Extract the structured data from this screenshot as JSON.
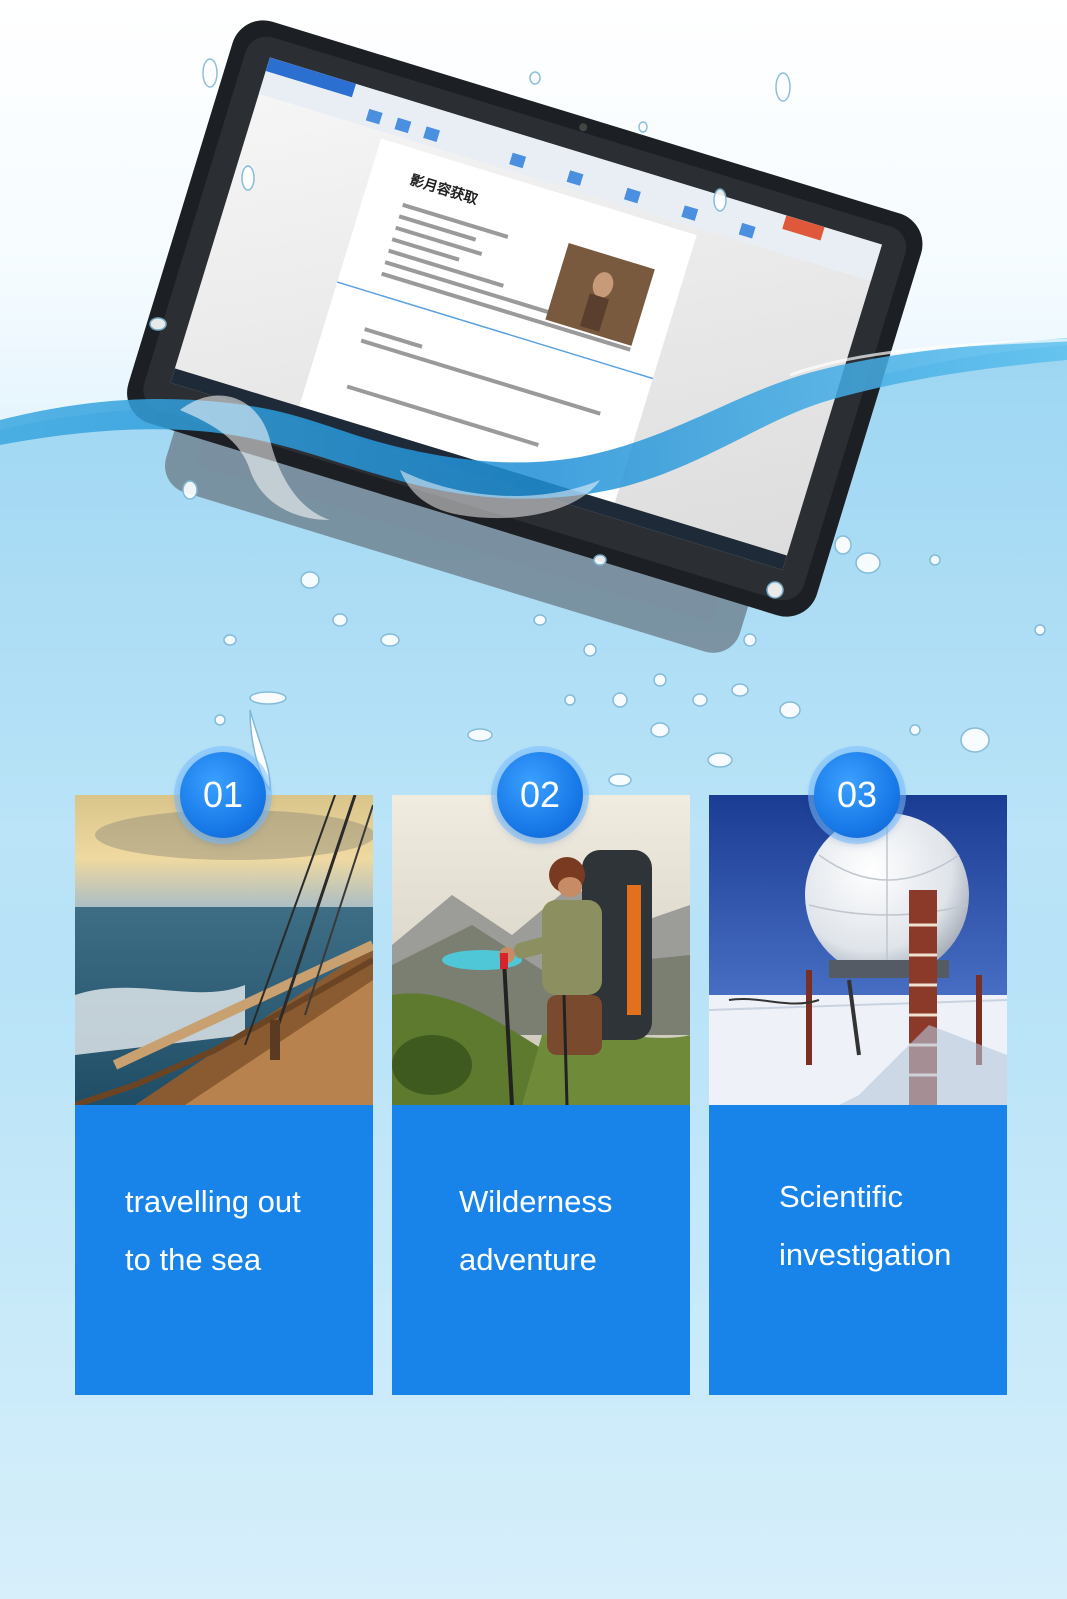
{
  "colors": {
    "card_blue": "#1884ea",
    "badge_blue": "#1677e6",
    "water": "#bfe5f8"
  },
  "hero": {
    "device": "rugged-tablet",
    "document_title": "影月容获取"
  },
  "cards": [
    {
      "number": "01",
      "lines": [
        "travelling out",
        "to the sea"
      ],
      "photo": "sailing-ship-deck-at-sea"
    },
    {
      "number": "02",
      "lines": [
        "Wilderness",
        "adventure"
      ],
      "photo": "hiker-with-backpack-mountain-lake"
    },
    {
      "number": "03",
      "lines": [
        "Scientific",
        "investigation"
      ],
      "photo": "radar-dome-on-snow"
    }
  ]
}
